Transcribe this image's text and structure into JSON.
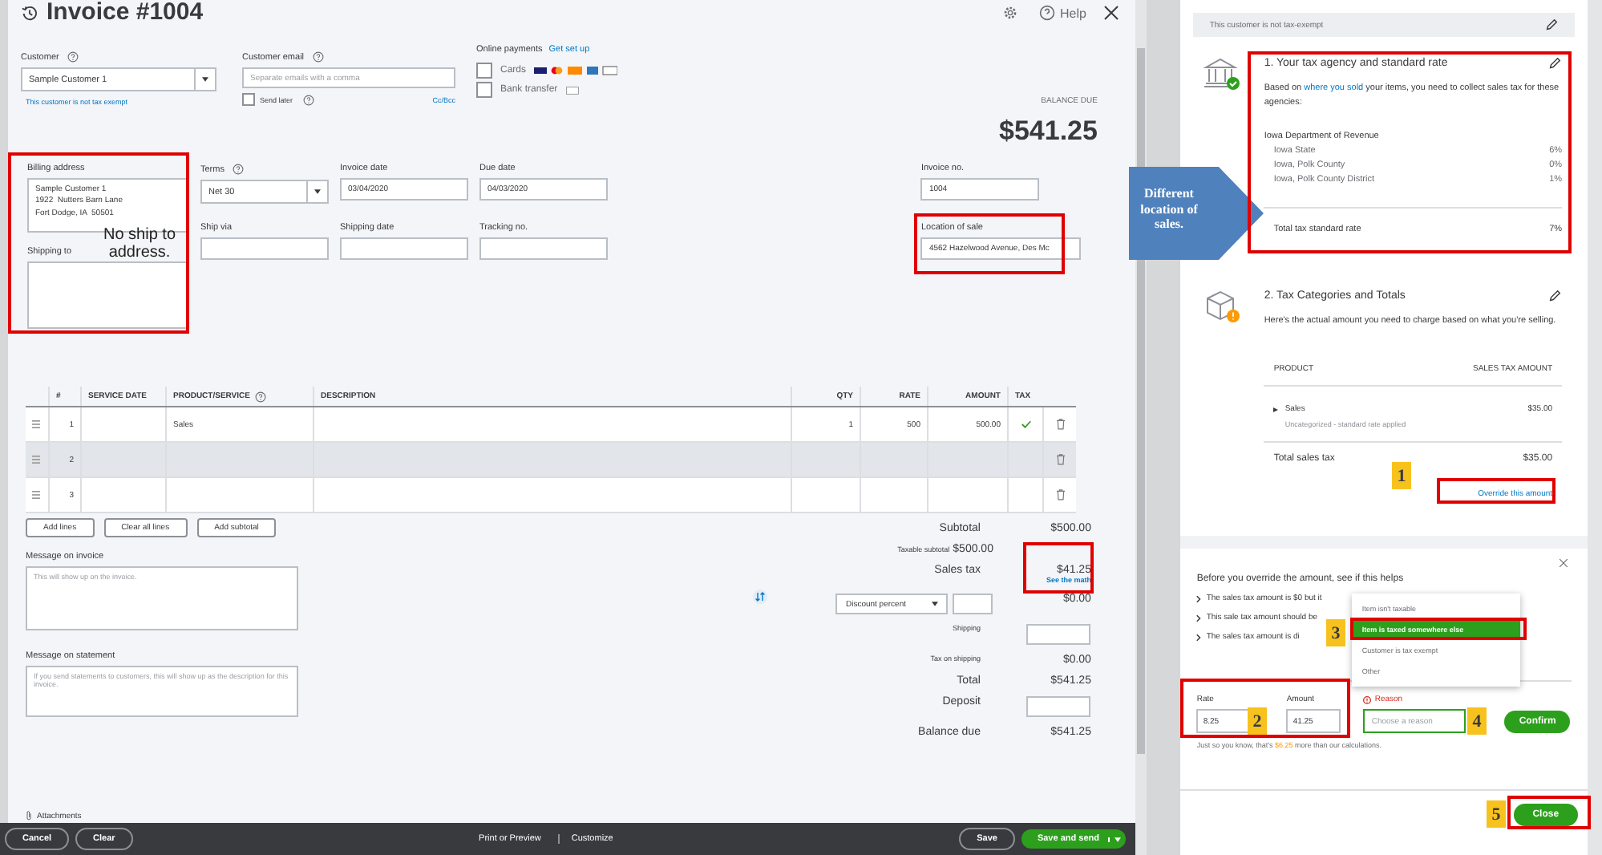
{
  "invoice": {
    "title": "Invoice #1004",
    "help": "Help",
    "customer": {
      "label": "Customer",
      "value": "Sample  Customer 1",
      "note": "This customer is not tax exempt"
    },
    "email": {
      "label": "Customer email",
      "placeholder": "Separate emails with a comma",
      "send_later": {
        "label": "Send later",
        "checked": false
      },
      "cc_bcc": "Cc/Bcc"
    },
    "online_payments": {
      "label": "Online payments",
      "link": "Get set up",
      "options": [
        {
          "label": "Cards",
          "checked": false,
          "kind": "cards"
        },
        {
          "label": "Bank transfer",
          "checked": false,
          "kind": "bank"
        }
      ]
    },
    "balance_due": {
      "label": "BALANCE DUE",
      "value": "$541.25"
    },
    "billing_address": {
      "label": "Billing address",
      "value": "Sample Customer 1\n1922  Nutters Barn Lane\nFort Dodge, IA  50501"
    },
    "shipping_to": {
      "label": "Shipping to"
    },
    "fields": [
      {
        "label": "Terms",
        "value": "Net 30",
        "kind": "select",
        "help": true
      },
      {
        "label": "Invoice date",
        "value": "03/04/2020",
        "kind": "text",
        "help": false
      },
      {
        "label": "Due date",
        "value": "04/03/2020",
        "kind": "text",
        "help": false
      },
      {
        "label": "Ship via",
        "kind": "text",
        "help": false
      },
      {
        "label": "Shipping date",
        "kind": "text",
        "help": false
      },
      {
        "label": "Tracking no.",
        "kind": "text",
        "help": false
      }
    ],
    "invoice_no": {
      "label": "Invoice no.",
      "value": "1004"
    },
    "location_of_sale": {
      "label": "Location of sale",
      "value": "4562  Hazelwood Avenue, Des Mc"
    },
    "table": {
      "columns": [
        "#",
        "SERVICE DATE",
        "PRODUCT/SERVICE",
        "DESCRIPTION",
        "QTY",
        "RATE",
        "AMOUNT",
        "TAX"
      ],
      "rows": [
        {
          "number": "1",
          "product": "Sales",
          "qty": "1",
          "rate": "500",
          "amount": "500.00",
          "taxable": true,
          "selected": false
        },
        {
          "number": "2",
          "taxable": false,
          "selected": true
        },
        {
          "number": "3",
          "taxable": false,
          "selected": false
        }
      ]
    },
    "table_buttons": [
      "Add lines",
      "Clear all lines",
      "Add subtotal"
    ],
    "messages": [
      {
        "label": "Message on invoice",
        "placeholder": "This will show up on the invoice."
      },
      {
        "label": "Message on statement",
        "placeholder": "If you send statements to customers, this will show up as the description for this invoice."
      }
    ],
    "totals": [
      {
        "kind": "major",
        "label": "Subtotal",
        "value": "$500.00"
      },
      {
        "kind": "inline",
        "label": "Taxable subtotal",
        "value": "$500.00"
      },
      {
        "kind": "tax",
        "label": "Sales tax",
        "value": "$41.25",
        "link": "See the math"
      },
      {
        "kind": "discount",
        "label": "Discount percent",
        "value": "$0.00"
      },
      {
        "kind": "minor_input",
        "label": "Shipping"
      },
      {
        "kind": "minor",
        "label": "Tax on shipping",
        "value": "$0.00"
      },
      {
        "kind": "major",
        "label": "Total",
        "value": "$541.25"
      },
      {
        "kind": "major_input",
        "label": "Deposit"
      },
      {
        "kind": "major",
        "label": "Balance due",
        "value": "$541.25"
      }
    ],
    "attachments": "Attachments",
    "footer": {
      "left": [
        "Cancel",
        "Clear"
      ],
      "center": [
        "Print or Preview",
        "Customize"
      ],
      "save": "Save",
      "save_and_send": "Save and send"
    }
  },
  "sales_tax_panel": {
    "tax_status": "This customer is not tax-exempt",
    "agency_section": {
      "title": "1. Your tax agency and standard rate",
      "text_before": "Based on ",
      "link": "where you sold",
      "text_after": " your items, you need to collect sales tax for these agencies:",
      "agency": "Iowa Department of Revenue",
      "rates": [
        {
          "name": "Iowa State",
          "rate": "6%"
        },
        {
          "name": "Iowa, Polk County",
          "rate": "0%"
        },
        {
          "name": "Iowa, Polk County District",
          "rate": "1%"
        }
      ],
      "total": {
        "label": "Total tax standard rate",
        "value": "7%"
      }
    },
    "categories_section": {
      "title": "2. Tax Categories and Totals",
      "text": "Here's the actual amount you need to charge based on what you're selling.",
      "columns": [
        "PRODUCT",
        "SALES TAX AMOUNT"
      ],
      "rows": [
        {
          "name": "Sales",
          "note": "Uncategorized - standard rate applied",
          "amount": "$35.00",
          "expanded": false
        }
      ],
      "total": {
        "label": "Total sales tax",
        "value": "$35.00"
      },
      "override_link": "Override this amount"
    },
    "override": {
      "title": "Before you override the amount, see if this helps",
      "tips": [
        "The sales tax amount is $0 but it",
        "This sale tax amount should be",
        "The sales tax amount is di"
      ],
      "rate": {
        "label": "Rate",
        "value": "8.25"
      },
      "amount": {
        "label": "Amount",
        "value": "41.25"
      },
      "reason": {
        "label": "Reason",
        "placeholder": "Choose a reason"
      },
      "reason_options": [
        {
          "label": "Item isn't taxable",
          "selected": false
        },
        {
          "label": "Item is taxed somewhere else",
          "selected": true
        },
        {
          "label": "Customer is tax exempt",
          "selected": false
        },
        {
          "label": "Other",
          "selected": false
        }
      ],
      "confirm": "Confirm",
      "note": {
        "before": "Just so you know, that's ",
        "amount": "$6.25",
        "after": " more than our calculations."
      }
    },
    "close": "Close"
  },
  "annotations": {
    "callout": "Different location of sales.",
    "note": "No ship to address.",
    "steps": [
      "1",
      "2",
      "3",
      "4",
      "5"
    ]
  }
}
